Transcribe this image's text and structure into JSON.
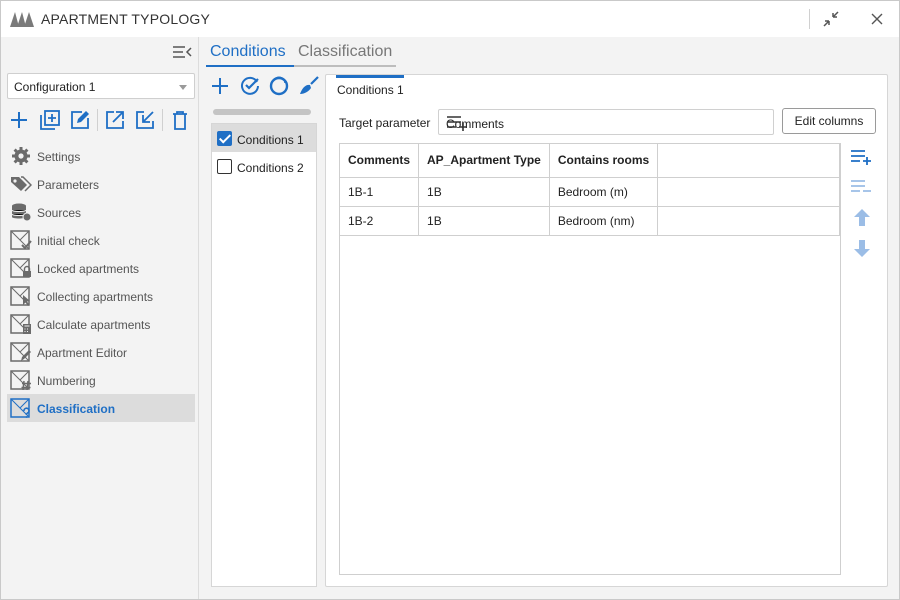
{
  "window": {
    "title": "APARTMENT TYPOLOGY"
  },
  "colors": {
    "accent": "#1f6fc5",
    "accent_light": "#9bbde6",
    "icon_gray": "#6b6b6b"
  },
  "left": {
    "configuration": "Configuration 1",
    "toolbar": [
      "add-icon",
      "duplicate-icon",
      "edit-icon",
      "export-icon",
      "import-icon",
      "delete-icon"
    ],
    "nav": [
      {
        "label": "Settings",
        "icon": "gear-icon"
      },
      {
        "label": "Parameters",
        "icon": "tags-icon"
      },
      {
        "label": "Sources",
        "icon": "database-icon"
      },
      {
        "label": "Initial check",
        "icon": "check-plan-icon"
      },
      {
        "label": "Locked apartments",
        "icon": "lock-plan-icon"
      },
      {
        "label": "Collecting apartments",
        "icon": "cursor-plan-icon"
      },
      {
        "label": "Calculate apartments",
        "icon": "calculator-plan-icon"
      },
      {
        "label": "Apartment Editor",
        "icon": "pencil-plan-icon"
      },
      {
        "label": "Numbering",
        "icon": "hash-plan-icon"
      },
      {
        "label": "Classification",
        "icon": "question-plan-icon",
        "active": true
      }
    ]
  },
  "tabs": {
    "active": "Conditions",
    "other": "Classification"
  },
  "conditions": {
    "toolbar": [
      "add-icon",
      "check-all-icon",
      "uncheck-all-icon",
      "clear-icon"
    ],
    "items": [
      {
        "label": "Conditions 1",
        "checked": true,
        "selected": true
      },
      {
        "label": "Conditions 2",
        "checked": false,
        "selected": false
      }
    ]
  },
  "panel": {
    "title": "Conditions 1",
    "target_label": "Target parameter",
    "target_value": "Comments",
    "edit_columns": "Edit columns",
    "columns": [
      "Comments",
      "AP_Apartment Type",
      "Contains rooms",
      ""
    ],
    "rows": [
      [
        "1B-1",
        "1B",
        "Bedroom  (m)",
        ""
      ],
      [
        "1B-2",
        "1B",
        "Bedroom  (nm)",
        ""
      ]
    ],
    "side_tools": [
      "add-row-icon",
      "remove-row-icon",
      "move-up-icon",
      "move-down-icon"
    ]
  }
}
